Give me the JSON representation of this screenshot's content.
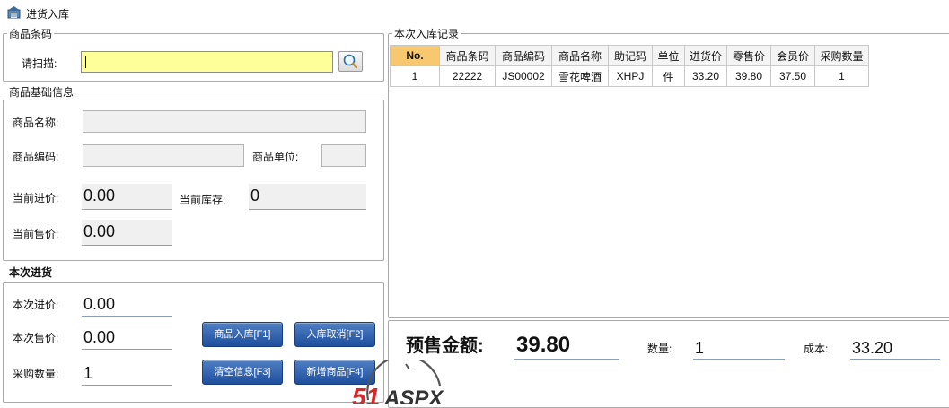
{
  "window": {
    "title": "进货入库"
  },
  "barcode_group": {
    "title": "商品条码",
    "scan_label": "请扫描:",
    "scan_value": ""
  },
  "basic_info": {
    "title": "商品基础信息",
    "name_label": "商品名称:",
    "code_label": "商品编码:",
    "unit_label": "商品单位:",
    "cur_in_price_label": "当前进价:",
    "cur_in_price": "0.00",
    "cur_stock_label": "当前库存:",
    "cur_stock": "0",
    "cur_sale_price_label": "当前售价:",
    "cur_sale_price": "0.00"
  },
  "purchase": {
    "title": "本次进货",
    "in_price_label": "本次进价:",
    "in_price": "0.00",
    "sale_price_label": "本次售价:",
    "sale_price": "0.00",
    "qty_label": "采购数量:",
    "qty": "1",
    "buttons": {
      "stock_in": "商品入库[F1]",
      "cancel": "入库取消[F2]",
      "clear": "清空信息[F3]",
      "new_item": "新增商品[F4]"
    }
  },
  "records": {
    "title": "本次入库记录",
    "columns": [
      "No.",
      "商品条码",
      "商品编码",
      "商品名称",
      "助记码",
      "单位",
      "进货价",
      "零售价",
      "会员价",
      "采购数量"
    ],
    "rows": [
      [
        "1",
        "22222",
        "JS00002",
        "雪花啤酒",
        "XHPJ",
        "件",
        "33.20",
        "39.80",
        "37.50",
        "1"
      ]
    ]
  },
  "summary": {
    "presale_label": "预售金额:",
    "presale_value": "39.80",
    "qty_label": "数量:",
    "qty_value": "1",
    "cost_label": "成本:",
    "cost_value": "33.20"
  },
  "watermark": {
    "text": "51ASPX"
  },
  "colors": {
    "scan_bg": "#ffff99",
    "button": "#2a5aa8",
    "header_highlight": "#f8c870"
  }
}
